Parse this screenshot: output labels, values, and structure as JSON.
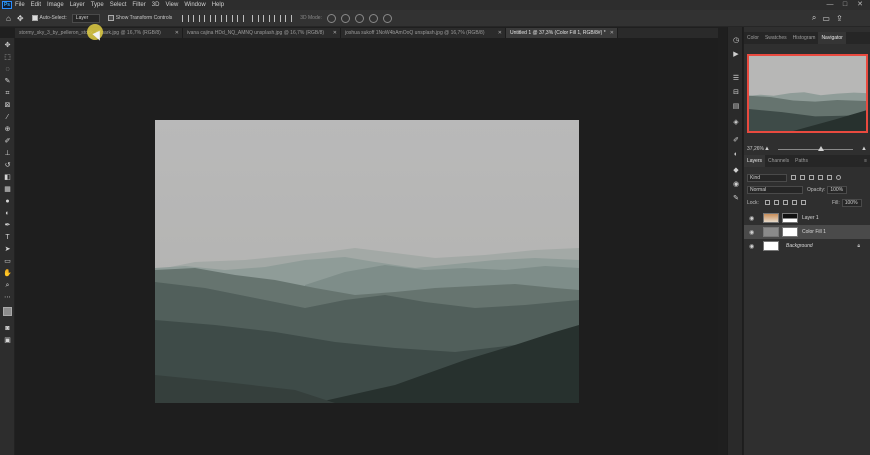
{
  "app": {
    "logo": "Ps"
  },
  "menu": [
    "File",
    "Edit",
    "Image",
    "Layer",
    "Type",
    "Select",
    "Filter",
    "3D",
    "View",
    "Window",
    "Help"
  ],
  "window_controls": {
    "minimize": "—",
    "maximize": "□",
    "close": "✕"
  },
  "options_bar": {
    "auto_select_label": "Auto-Select:",
    "auto_select_checked": true,
    "auto_select_target": "Layer",
    "transform_label": "Show Transform Controls",
    "transform_checked": false,
    "mode_3d_label": "3D Mode:"
  },
  "tabs": [
    {
      "label": "stormy_sky_3_by_pelleron_stock_d2oark.jpg @ 16,7% (RGB/8)",
      "active": false
    },
    {
      "label": "ivana cajina HDd_NQ_AMNQ unsplash.jpg @ 16,7% (RGB/8)",
      "active": false
    },
    {
      "label": "joshua sukoff 1NoW4bAmOoQ unsplash.jpg @ 16,7% (RGB/8)",
      "active": false
    },
    {
      "label": "Untitled 1 @ 37,3% (Color Fill 1, RGB/8#) *",
      "active": true
    }
  ],
  "top_panel": {
    "tabs": [
      "Color",
      "Swatches",
      "Histogram",
      "Navigator"
    ],
    "active_tab": "Navigator",
    "zoom": "37,26%"
  },
  "layers_panel": {
    "tabs": [
      "Layers",
      "Channels",
      "Paths"
    ],
    "active_tab": "Layers",
    "filter_kind": "Kind",
    "blend_mode": "Normal",
    "opacity_label": "Opacity:",
    "opacity_value": "100%",
    "lock_label": "Lock:",
    "fill_label": "Fill:",
    "fill_value": "100%",
    "layers": [
      {
        "name": "Layer 1",
        "selected": false,
        "italic": false
      },
      {
        "name": "Color Fill 1",
        "selected": true,
        "italic": false
      },
      {
        "name": "Background",
        "selected": false,
        "italic": true,
        "locked": true
      }
    ]
  },
  "colors": {
    "accent_red": "#e94a3f",
    "photoshop_blue": "#31a8ff",
    "selected_row": "#4a4a4a",
    "cursor_highlight": "#e0ce43"
  },
  "icons": {
    "tools": [
      "move-tool-icon",
      "artboard-icon",
      "marquee-tool-icon",
      "lasso-tool-icon",
      "quick-select-icon",
      "crop-tool-icon",
      "frame-tool-icon",
      "eyedropper-icon",
      "healing-brush-icon",
      "brush-tool-icon",
      "clone-stamp-icon",
      "history-brush-icon",
      "eraser-icon",
      "gradient-icon",
      "blur-icon",
      "dodge-icon",
      "pen-tool-icon",
      "type-tool-icon",
      "path-select-icon",
      "shape-tool-icon",
      "hand-tool-icon",
      "zoom-tool-icon",
      "more-tools-icon",
      "color-swatches-icon",
      "quick-mask-icon",
      "screen-mode-icon"
    ]
  }
}
